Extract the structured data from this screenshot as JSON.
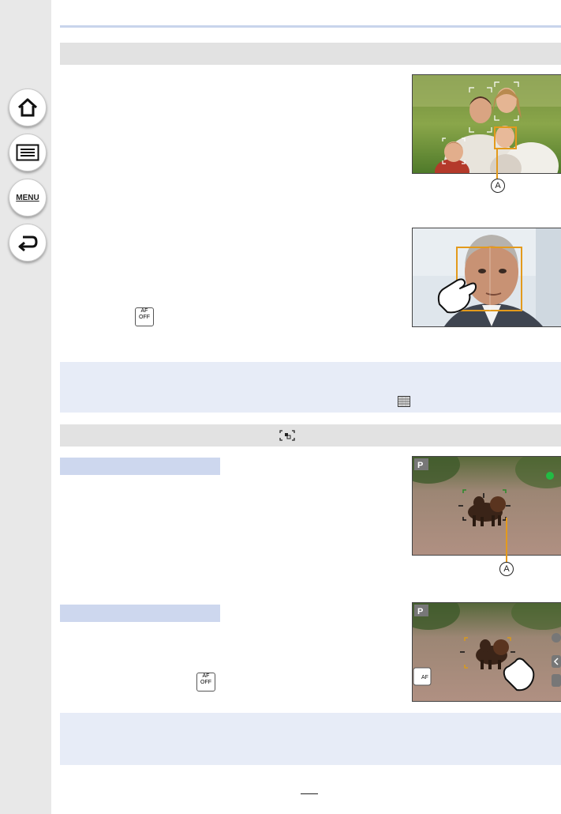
{
  "sidebar": {
    "buttons": [
      {
        "name": "home",
        "icon": "home-icon"
      },
      {
        "name": "contents",
        "icon": "list-icon"
      },
      {
        "name": "menu",
        "icon": "menu-icon",
        "label": "MENU"
      },
      {
        "name": "back",
        "icon": "back-arrow-icon"
      }
    ]
  },
  "sections": {
    "face_detection_bar": {
      "label": ""
    },
    "tracking_bar": {
      "label": "",
      "icon": "tracking-af-icon"
    }
  },
  "subheads": {
    "first": "",
    "second": ""
  },
  "callouts": {
    "a1": "A",
    "a2": "A"
  },
  "photos": {
    "family": {
      "icon": "face-detection-photo"
    },
    "man_touch": {
      "icon": "touch-af-photo"
    },
    "dog_tracking": {
      "mode_badge": "P"
    },
    "dog_touch": {
      "mode_badge": "P",
      "af_off_label": "AF"
    }
  },
  "icons": {
    "af_off": {
      "top": "AF",
      "bottom": "OFF"
    },
    "grid": "grid-icon"
  },
  "colors": {
    "sidebar": "#e8e8e8",
    "section_bar": "#e2e2e2",
    "subhead": "#cdd7ee",
    "note_bg": "#e7ecf7",
    "accent_line": "#c8d4ec",
    "af_frame": "#e39a1c"
  }
}
